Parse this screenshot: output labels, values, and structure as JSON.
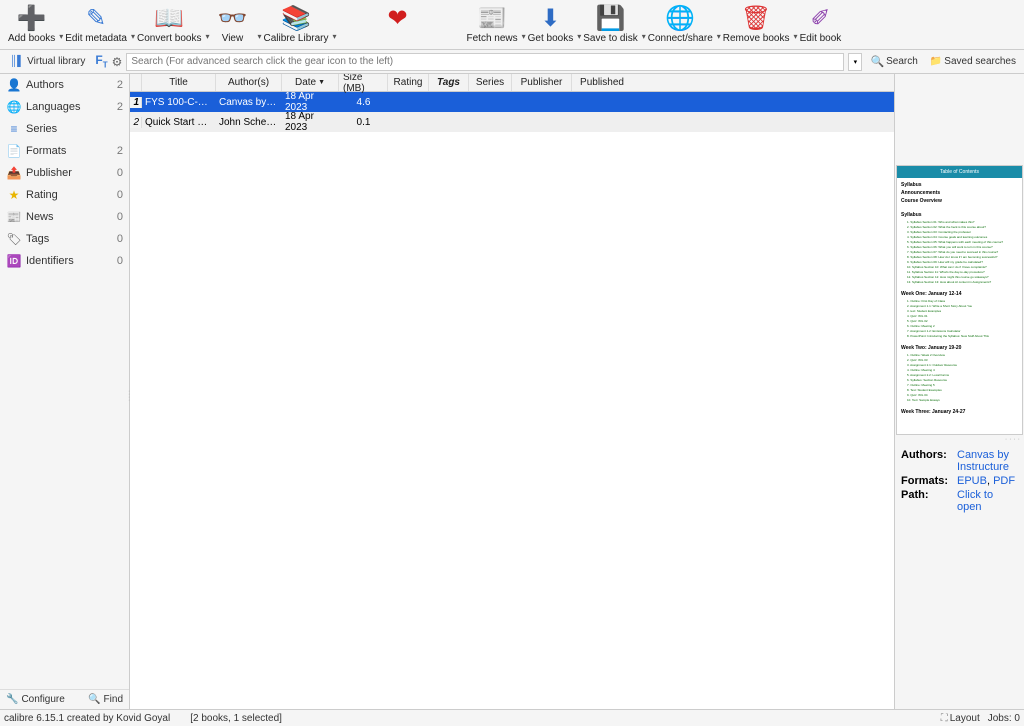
{
  "toolbar": [
    {
      "name": "add-books",
      "label": "Add books",
      "icon": "➕",
      "color": "#4a9b2f",
      "arrow": true
    },
    {
      "name": "edit-metadata",
      "label": "Edit metadata",
      "icon": "✎",
      "color": "#3a7bd5",
      "arrow": true
    },
    {
      "name": "convert-books",
      "label": "Convert books",
      "icon": "📖",
      "color": "#c08530",
      "arrow": true
    },
    {
      "name": "view",
      "label": "View",
      "icon": "👓",
      "color": "#6fa828",
      "arrow": true
    },
    {
      "name": "calibre-library",
      "label": "Calibre Library",
      "icon": "📚",
      "color": "#a0623c",
      "arrow": true
    },
    {
      "name": "donate",
      "label": "",
      "icon": "❤",
      "color": "#d11e1e",
      "arrow": false,
      "heart": true
    },
    {
      "name": "fetch-news",
      "label": "Fetch news",
      "icon": "📰",
      "color": "#888",
      "arrow": true
    },
    {
      "name": "get-books",
      "label": "Get books",
      "icon": "⬇",
      "color": "#2e6cc4",
      "arrow": true
    },
    {
      "name": "save-to-disk",
      "label": "Save to disk",
      "icon": "💾",
      "color": "#4a78c9",
      "arrow": true
    },
    {
      "name": "connect-share",
      "label": "Connect/share",
      "icon": "🌐",
      "color": "#3a6fa8",
      "arrow": true
    },
    {
      "name": "remove-books",
      "label": "Remove books",
      "icon": "🗑",
      "color": "#d33",
      "arrow": true
    },
    {
      "name": "edit-book",
      "label": "Edit book",
      "icon": "✐",
      "color": "#8e44ad",
      "arrow": false
    }
  ],
  "searchbar": {
    "virtual_library": "Virtual library",
    "placeholder": "Search (For advanced search click the gear icon to the left)",
    "search_btn": "Search",
    "saved_btn": "Saved searches"
  },
  "sidebar": {
    "items": [
      {
        "name": "authors",
        "label": "Authors",
        "count": "2",
        "icon": "👤",
        "color": "#3a7bd5"
      },
      {
        "name": "languages",
        "label": "Languages",
        "count": "2",
        "icon": "🌐",
        "color": "#4a9b2f"
      },
      {
        "name": "series",
        "label": "Series",
        "count": "",
        "icon": "≡",
        "color": "#3a7bd5"
      },
      {
        "name": "formats",
        "label": "Formats",
        "count": "2",
        "icon": "📄",
        "color": "#8e44ad"
      },
      {
        "name": "publisher",
        "label": "Publisher",
        "count": "0",
        "icon": "📤",
        "color": "#c08530"
      },
      {
        "name": "rating",
        "label": "Rating",
        "count": "0",
        "icon": "★",
        "color": "#e8b500"
      },
      {
        "name": "news",
        "label": "News",
        "count": "0",
        "icon": "📰",
        "color": "#888"
      },
      {
        "name": "tags",
        "label": "Tags",
        "count": "0",
        "icon": "🏷",
        "color": "#555"
      },
      {
        "name": "identifiers",
        "label": "Identifiers",
        "count": "0",
        "icon": "🆔",
        "color": "#4a9b2f"
      }
    ],
    "configure": "Configure",
    "find": "Find"
  },
  "grid": {
    "headers": {
      "title": "Title",
      "authors": "Author(s)",
      "date": "Date",
      "size": "Size (MB)",
      "rating": "Rating",
      "tags": "Tags",
      "series": "Series",
      "publisher": "Publisher",
      "published": "Published"
    },
    "rows": [
      {
        "n": "1",
        "title": "FYS 100-C-Firs...",
        "authors": "Canvas by Ins...",
        "date": "18 Apr 2023",
        "size": "4.6",
        "selected": true
      },
      {
        "n": "2",
        "title": "Quick Start Guide",
        "authors": "John Schember",
        "date": "18 Apr 2023",
        "size": "0.1",
        "selected": false
      }
    ]
  },
  "cover": {
    "toc": "Table of Contents",
    "s1": "Syllabus",
    "s2": "Announcements",
    "s3": "Course Overview",
    "syllabus": "Syllabus",
    "syl_lines": [
      "1. Syllabus Section 01: Who and what makes this?",
      "2. Syllabus Section 02: What the heck is this course about?",
      "3. Syllabus Section 03: Contacting the professor",
      "4. Syllabus Section 04: Course goals and learning outcomes",
      "5. Syllabus Section 05: What happens with each meeting of this course?",
      "6. Syllabus Section 06: What you will work to turn in this course?",
      "7. Syllabus Section 07: What do you need to succeed in this course?",
      "8. Syllabus Section 08: How do I know if I am becoming successful?",
      "9. Syllabus Section 09: How will my grade be calculated?",
      "10. Syllabus Section 10: What can I do if I have complaints?",
      "11. Syllabus Section 11: What's the day-to-day procedure?",
      "12. Syllabus Section 12: How might this course go sideways?",
      "13. Syllabus Section 13: How about AI content in Assignments?"
    ],
    "w1": "Week One: January 12-14",
    "w1_lines": [
      "1. Outline: First Day of Class",
      "2. Assignment 1.1: Write a Short Story About You",
      "3. text: Student Examples",
      "4. Quiz: WIL 01",
      "5. Quiz: WIL 02",
      "6. Outline: Meeting 2",
      "7. Assignment 1.2: Emissions Calculator",
      "8. PowerPoint: Introducing the Syllabus: New Stuff About This"
    ],
    "w2": "Week Two: January 19-20",
    "w2_lines": [
      "1. Outline: Week 2 Overview",
      "2. Quiz: WIL 03",
      "3. Assignment 2.1: Outdoor Resource",
      "4. Outline: Meeting 4",
      "5. Assignment 2.2: Local Farms",
      "6. Syllabus: Section Resource",
      "7. Outline: Meeting 5",
      "8. Text: Student Examples",
      "9. Quiz: WIL 04",
      "10. Text: Sample Essays"
    ],
    "w3": "Week Three: January 24-27"
  },
  "details": {
    "authors_k": "Authors:",
    "authors_v": "Canvas by Instructure",
    "formats_k": "Formats:",
    "formats_v1": "EPUB",
    "formats_sep": ", ",
    "formats_v2": "PDF",
    "path_k": "Path:",
    "path_v": "Click to open"
  },
  "status": {
    "left": "calibre 6.15.1 created by Kovid Goyal",
    "center": "[2 books, 1 selected]",
    "layout": "Layout",
    "jobs": "Jobs: 0"
  }
}
